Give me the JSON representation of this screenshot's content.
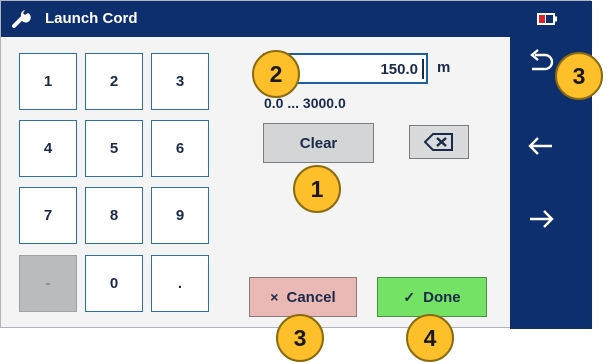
{
  "window": {
    "title": "Launch Cord",
    "title_icon": "wrench-icon",
    "battery_icon": "battery-low-icon"
  },
  "keypad": {
    "keys": [
      {
        "label": "1",
        "enabled": true
      },
      {
        "label": "2",
        "enabled": true
      },
      {
        "label": "3",
        "enabled": true
      },
      {
        "label": "4",
        "enabled": true
      },
      {
        "label": "5",
        "enabled": true
      },
      {
        "label": "6",
        "enabled": true
      },
      {
        "label": "7",
        "enabled": true
      },
      {
        "label": "8",
        "enabled": true
      },
      {
        "label": "9",
        "enabled": true
      },
      {
        "label": "-",
        "enabled": false
      },
      {
        "label": "0",
        "enabled": true
      },
      {
        "label": ".",
        "enabled": true
      }
    ]
  },
  "entry": {
    "value": "150.0",
    "unit": "m",
    "range": "0.0 ... 3000.0"
  },
  "buttons": {
    "clear": "Clear",
    "backspace_icon": "backspace-icon",
    "cancel": "Cancel",
    "cancel_glyph": "×",
    "done": "Done",
    "done_glyph": "✓"
  },
  "sidebar": {
    "items": [
      "undo-icon",
      "arrow-left-icon",
      "arrow-right-icon"
    ]
  },
  "callouts": [
    "2",
    "3",
    "1",
    "3",
    "4"
  ],
  "colors": {
    "titlebar": "#0d2f6e",
    "cancel": "#eab8b5",
    "done": "#73e265",
    "callout": "#fdbf2a"
  }
}
